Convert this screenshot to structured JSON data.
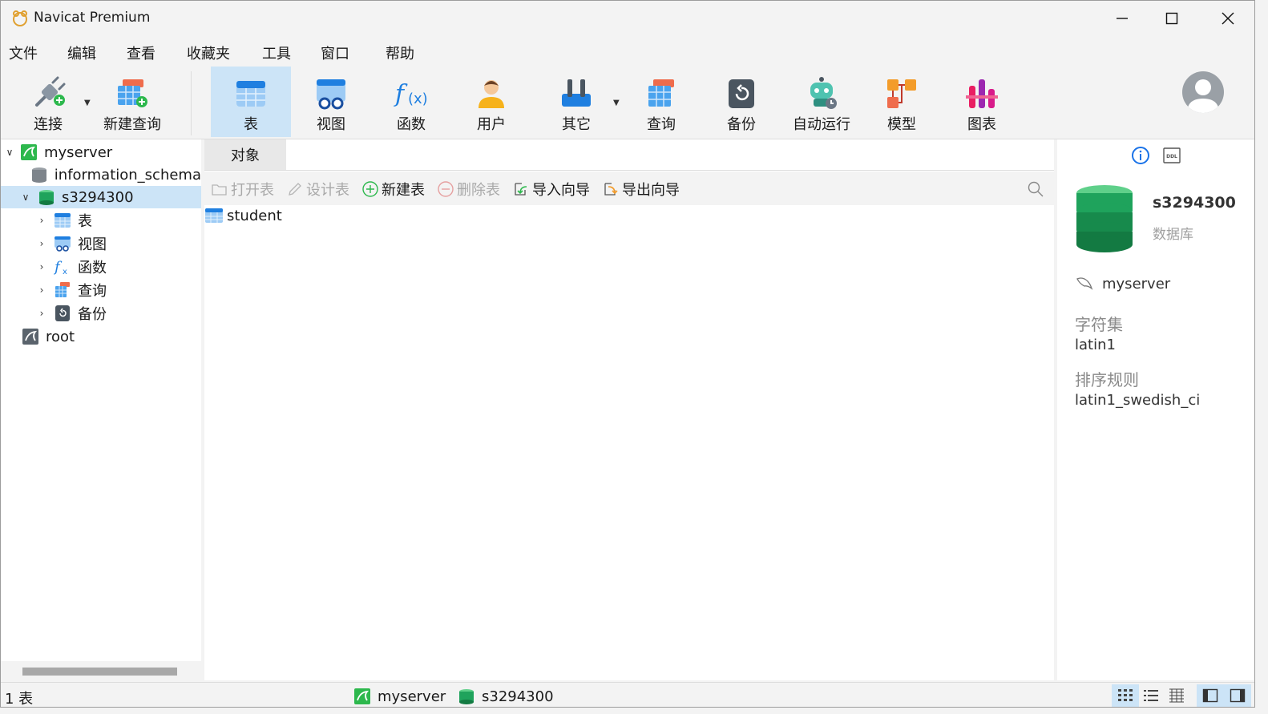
{
  "window": {
    "title": "Navicat Premium"
  },
  "menu": [
    "文件",
    "编辑",
    "查看",
    "收藏夹",
    "工具",
    "窗口",
    "帮助"
  ],
  "toolbar": {
    "connect": "连接",
    "new_query": "新建查询",
    "table": "表",
    "view": "视图",
    "function": "函数",
    "user": "用户",
    "other": "其它",
    "query": "查询",
    "backup": "备份",
    "automation": "自动运行",
    "model": "模型",
    "chart": "图表"
  },
  "tree": {
    "myserver": "myserver",
    "information_schema": "information_schema",
    "db": "s3294300",
    "table": "表",
    "view": "视图",
    "function": "函数",
    "query": "查询",
    "backup": "备份",
    "root": "root"
  },
  "tabs": {
    "objects": "对象"
  },
  "object_toolbar": {
    "open_table": "打开表",
    "design_table": "设计表",
    "new_table": "新建表",
    "delete_table": "删除表",
    "import_wizard": "导入向导",
    "export_wizard": "导出向导"
  },
  "objects": [
    "student"
  ],
  "info": {
    "db_name": "s3294300",
    "db_type": "数据库",
    "server": "myserver",
    "charset_label": "字符集",
    "charset": "latin1",
    "collation_label": "排序规则",
    "collation": "latin1_swedish_ci"
  },
  "status": {
    "count": "1 表",
    "server": "myserver",
    "db": "s3294300"
  },
  "colors": {
    "selection": "#cce4f7",
    "accent_blue": "#1a73e8",
    "db_green": "#1fa35c"
  }
}
